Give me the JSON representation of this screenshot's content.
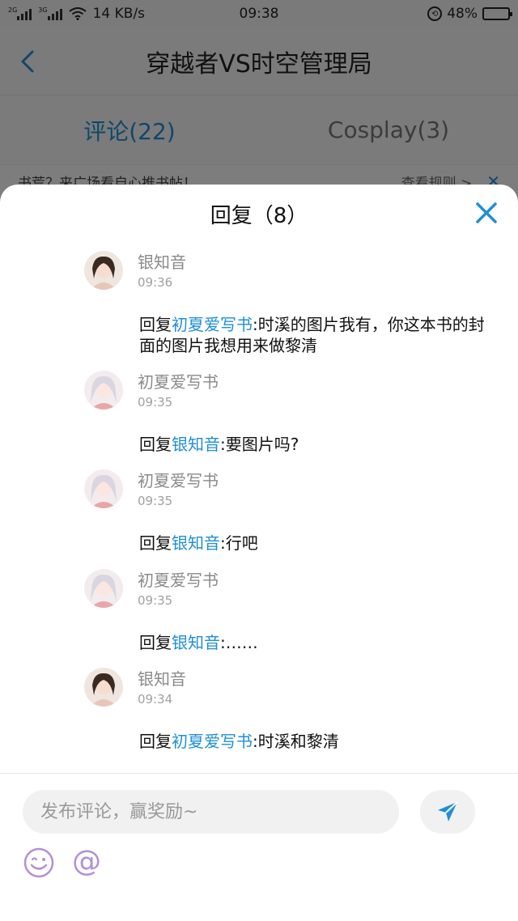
{
  "status_bar": {
    "network_label_1": "2G",
    "network_label_2": "3G",
    "speed": "14 KB/s",
    "time": "09:38",
    "battery": "48%",
    "battery_level": 0.48
  },
  "nav": {
    "title": "穿越者VS时空管理局"
  },
  "tabs": [
    {
      "label": "评论(22)",
      "active": true
    },
    {
      "label": "Cosplay(3)",
      "active": false
    }
  ],
  "notice": {
    "text": "书荒？来广场看自心推书帖！",
    "link": "查看规则 >"
  },
  "sheet": {
    "title": "回复（8）"
  },
  "replies": [
    {
      "name": "银知音",
      "time": "09:36",
      "prefix": "回复",
      "target": "初夏爱写书",
      "body": ":时溪的图片我有，你这本书的封面的图片我想用来做黎清"
    },
    {
      "name": "初夏爱写书",
      "time": "09:35",
      "prefix": "回复",
      "target": "银知音",
      "body": ":要图片吗?"
    },
    {
      "name": "初夏爱写书",
      "time": "09:35",
      "prefix": "回复",
      "target": "银知音",
      "body": ":行吧"
    },
    {
      "name": "初夏爱写书",
      "time": "09:35",
      "prefix": "回复",
      "target": "银知音",
      "body": ":……"
    },
    {
      "name": "银知音",
      "time": "09:34",
      "prefix": "回复",
      "target": "初夏爱写书",
      "body": ":时溪和黎清"
    }
  ],
  "composer": {
    "placeholder": "发布评论，赢奖励~",
    "at_symbol": "@"
  },
  "colors": {
    "accent": "#1f8fd6",
    "emoji": "#b48fd6"
  },
  "icons": [
    "back-icon",
    "close-icon",
    "send-icon",
    "emoji-icon",
    "at-icon",
    "wifi-icon",
    "lock-icon"
  ]
}
